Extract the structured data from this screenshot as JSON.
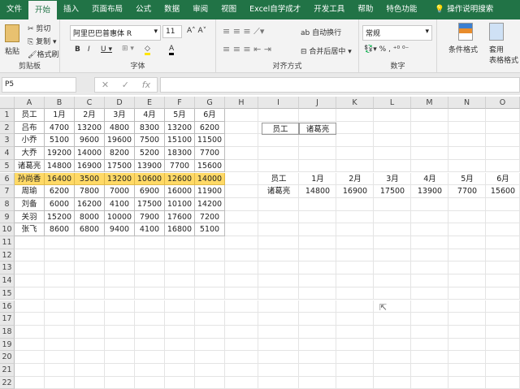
{
  "tabs": [
    "文件",
    "开始",
    "插入",
    "页面布局",
    "公式",
    "数据",
    "审阅",
    "视图",
    "Excel自学成才",
    "开发工具",
    "帮助",
    "特色功能",
    "操作说明搜索"
  ],
  "ribbon": {
    "paste": "粘贴",
    "cut": "剪切",
    "copy": "复制",
    "format_painter": "格式刷",
    "clipboard": "剪贴板",
    "font_name": "阿里巴巴普惠体 R",
    "font_size": "11",
    "font_group": "字体",
    "wrap": "自动换行",
    "merge": "合并后居中",
    "align_group": "对齐方式",
    "number_format": "常规",
    "number_group": "数字",
    "cond_format": "条件格式",
    "table_format_1": "套用",
    "table_format_2": "表格格式"
  },
  "formula_bar": {
    "name_box": "P5",
    "formula": ""
  },
  "columns": [
    "A",
    "B",
    "C",
    "D",
    "E",
    "F",
    "G",
    "H",
    "I",
    "J",
    "K",
    "L",
    "M",
    "N",
    "O"
  ],
  "table": {
    "header": [
      "员工",
      "1月",
      "2月",
      "3月",
      "4月",
      "5月",
      "6月"
    ],
    "rows": [
      [
        "吕布",
        "4700",
        "13200",
        "4800",
        "8300",
        "13200",
        "6200"
      ],
      [
        "小乔",
        "5100",
        "9600",
        "19600",
        "7500",
        "15100",
        "11500"
      ],
      [
        "大乔",
        "19200",
        "14000",
        "8200",
        "5200",
        "18300",
        "7700"
      ],
      [
        "诸葛亮",
        "14800",
        "16900",
        "17500",
        "13900",
        "7700",
        "15600"
      ],
      [
        "孙尚香",
        "16400",
        "3500",
        "13200",
        "10600",
        "12600",
        "14000"
      ],
      [
        "周瑜",
        "6200",
        "7800",
        "7000",
        "6900",
        "16000",
        "11900"
      ],
      [
        "刘备",
        "6000",
        "16200",
        "4100",
        "17500",
        "10100",
        "14200"
      ],
      [
        "关羽",
        "15200",
        "8000",
        "10000",
        "7900",
        "17600",
        "7200"
      ],
      [
        "张飞",
        "8600",
        "6800",
        "9400",
        "4100",
        "16800",
        "5100"
      ]
    ],
    "highlight_row": 4,
    "highlight_color": "#ffd966"
  },
  "lookup": {
    "label": "员工",
    "value": "诸葛亮"
  },
  "result": {
    "header": [
      "员工",
      "1月",
      "2月",
      "3月",
      "4月",
      "5月",
      "6月"
    ],
    "row": [
      "诸葛亮",
      "14800",
      "16900",
      "17500",
      "13900",
      "7700",
      "15600"
    ]
  }
}
